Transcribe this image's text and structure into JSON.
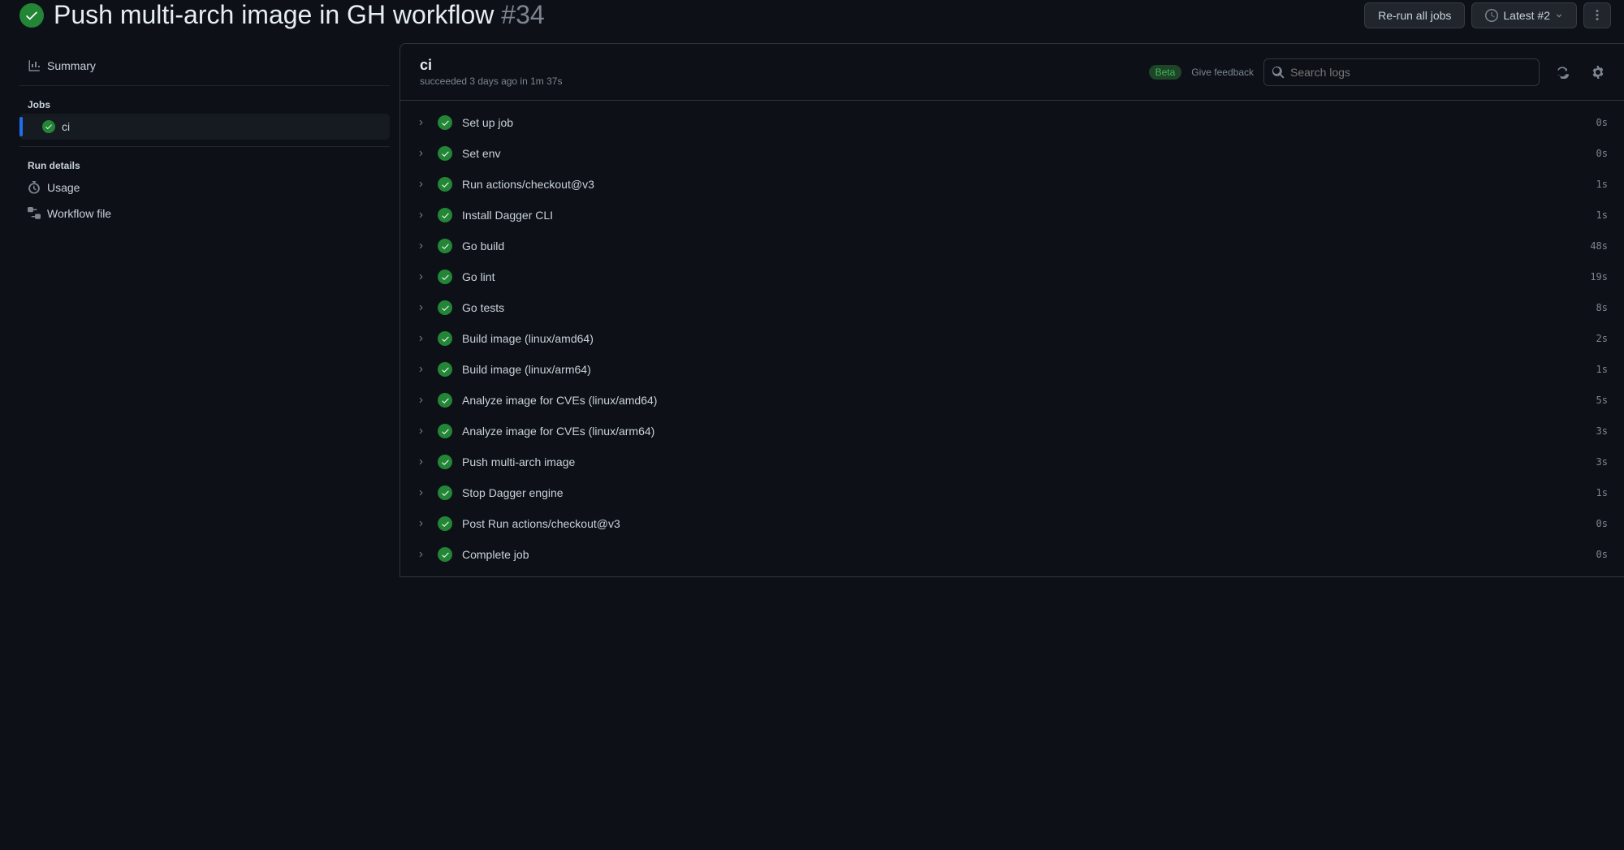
{
  "workflow": {
    "name": "Push multi-arch image in GH workflow",
    "number": "#34"
  },
  "header_actions": {
    "rerun": "Re-run all jobs",
    "latest": "Latest #2"
  },
  "sidebar": {
    "summary": "Summary",
    "jobs_heading": "Jobs",
    "job_name": "ci",
    "run_details_heading": "Run details",
    "usage": "Usage",
    "workflow_file": "Workflow file"
  },
  "panel": {
    "title": "ci",
    "subtitle": "succeeded 3 days ago in 1m 37s",
    "beta": "Beta",
    "feedback": "Give feedback",
    "search_placeholder": "Search logs"
  },
  "steps": [
    {
      "name": "Set up job",
      "duration": "0s"
    },
    {
      "name": "Set env",
      "duration": "0s"
    },
    {
      "name": "Run actions/checkout@v3",
      "duration": "1s"
    },
    {
      "name": "Install Dagger CLI",
      "duration": "1s"
    },
    {
      "name": "Go build",
      "duration": "48s"
    },
    {
      "name": "Go lint",
      "duration": "19s"
    },
    {
      "name": "Go tests",
      "duration": "8s"
    },
    {
      "name": "Build image (linux/amd64)",
      "duration": "2s"
    },
    {
      "name": "Build image (linux/arm64)",
      "duration": "1s"
    },
    {
      "name": "Analyze image for CVEs (linux/amd64)",
      "duration": "5s"
    },
    {
      "name": "Analyze image for CVEs (linux/arm64)",
      "duration": "3s"
    },
    {
      "name": "Push multi-arch image",
      "duration": "3s"
    },
    {
      "name": "Stop Dagger engine",
      "duration": "1s"
    },
    {
      "name": "Post Run actions/checkout@v3",
      "duration": "0s"
    },
    {
      "name": "Complete job",
      "duration": "0s"
    }
  ]
}
